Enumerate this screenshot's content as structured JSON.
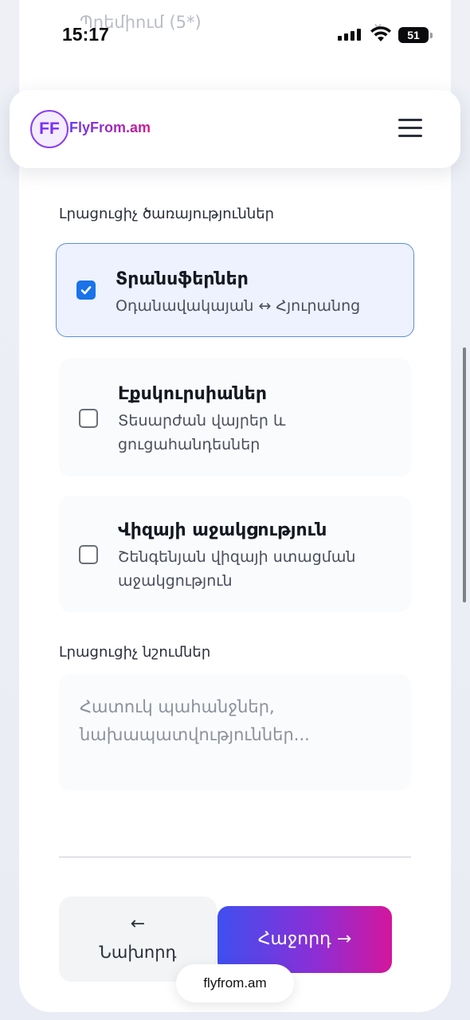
{
  "status_bar": {
    "time": "15:17",
    "battery": "51"
  },
  "faded_above": {
    "text": "Պրեմիում (5*)"
  },
  "header": {
    "logo_badge": "FF",
    "logo_text": "FlyFrom.am"
  },
  "services": {
    "label": "Լրացուցիչ ծառայություններ",
    "items": [
      {
        "title": "Տրանսֆերներ",
        "subtitle": "Օդանավակայան ↔ Հյուրանոց",
        "checked": true
      },
      {
        "title": "Էքսկուրսիաներ",
        "subtitle_lines": [
          "Տեսարժան վայրեր և",
          "ցուցահանդեսներ"
        ],
        "checked": false
      },
      {
        "title": "Վիզայի աջակցություն",
        "subtitle_lines": [
          "Շենգենյան վիզայի ստացման",
          "աջակցություն"
        ],
        "checked": false
      }
    ]
  },
  "notes": {
    "label": "Լրացուցիչ նշումներ",
    "placeholder": "Հատուկ պահանջներ, նախապատվություններ...",
    "value": ""
  },
  "nav": {
    "prev_arrow": "←",
    "prev_label": "Նախորդ",
    "next_label": "Հաջորդ →"
  },
  "browser": {
    "url": "flyfrom.am"
  },
  "colors": {
    "accent": "#1a73e8",
    "gradient_start": "#3f4ff0",
    "gradient_end": "#d4169c"
  }
}
